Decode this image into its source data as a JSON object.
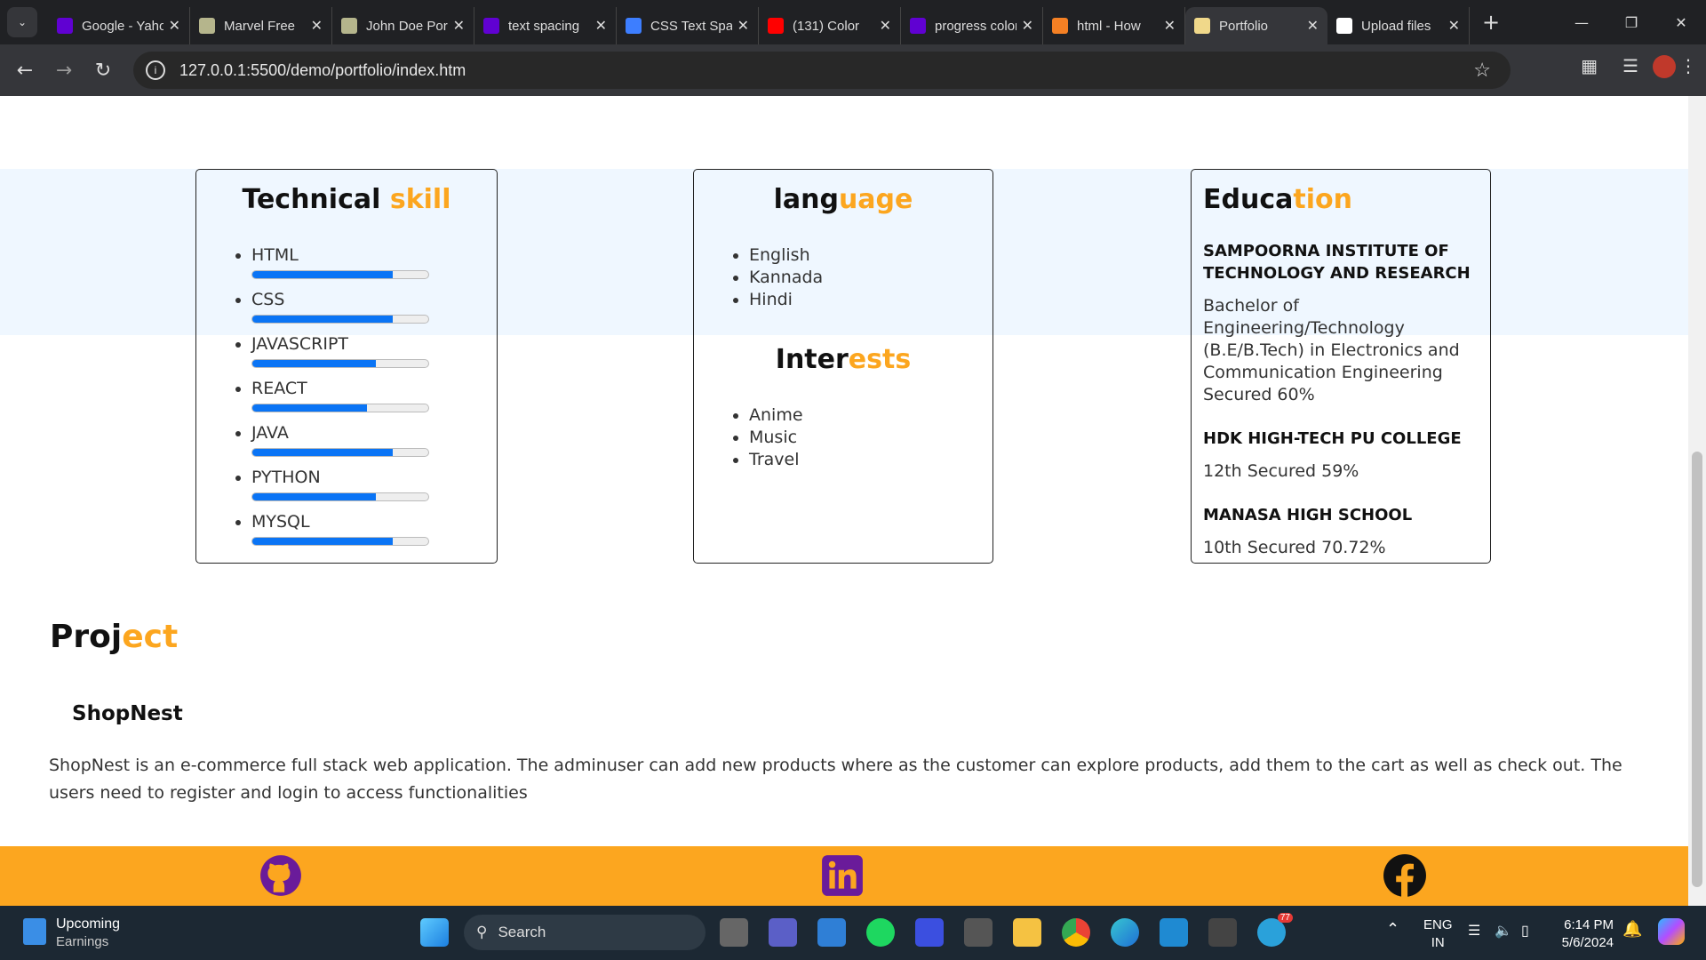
{
  "browser": {
    "tabs": [
      {
        "title": "Google - Yahoo",
        "icon": "yahoo-icon",
        "color": "#6001d2"
      },
      {
        "title": "Marvel Free",
        "icon": "page-icon",
        "color": "#b5b58c"
      },
      {
        "title": "John Doe Portfolio",
        "icon": "page-icon",
        "color": "#b5b58c"
      },
      {
        "title": "text spacing",
        "icon": "yahoo-icon",
        "color": "#6001d2"
      },
      {
        "title": "CSS Text Spacing",
        "icon": "css-icon",
        "color": "#3d7eff"
      },
      {
        "title": "(131) Color",
        "icon": "youtube-icon",
        "color": "#ff0000"
      },
      {
        "title": "progress color",
        "icon": "yahoo-icon",
        "color": "#6001d2"
      },
      {
        "title": "html - How",
        "icon": "stackoverflow-icon",
        "color": "#f48024"
      },
      {
        "title": "Portfolio",
        "icon": "portfolio-icon",
        "color": "#f0d88a",
        "active": true
      },
      {
        "title": "Upload files",
        "icon": "github-icon",
        "color": "#ffffff"
      }
    ],
    "url": "127.0.0.1:5500/demo/portfolio/index.htm"
  },
  "skills": {
    "title_a": "Technical ",
    "title_b": "skill",
    "items": [
      {
        "name": "HTML",
        "level": 80
      },
      {
        "name": "CSS",
        "level": 80
      },
      {
        "name": "JAVASCRIPT",
        "level": 70
      },
      {
        "name": "REACT",
        "level": 65
      },
      {
        "name": "JAVA",
        "level": 80
      },
      {
        "name": "PYTHON",
        "level": 70
      },
      {
        "name": "MYSQL",
        "level": 80
      }
    ],
    "bar_color": "#0a74f5"
  },
  "language": {
    "title_a": "lang",
    "title_b": "uage",
    "items": [
      "English",
      "Kannada",
      "Hindi"
    ]
  },
  "interests": {
    "title_a": "Inter",
    "title_b": "ests",
    "items": [
      "Anime",
      "Music",
      "Travel"
    ]
  },
  "education": {
    "title_a": "Educa",
    "title_b": "tion",
    "items": [
      {
        "school": "SAMPOORNA INSTITUTE OF TECHNOLOGY AND RESEARCH",
        "detail": "Bachelor of Engineering/Technology (B.E/B.Tech) in Electronics and Communication Engineering Secured 60%"
      },
      {
        "school": "HDK HIGH-TECH PU COLLEGE",
        "detail": "12th Secured 59%"
      },
      {
        "school": "MANASA HIGH SCHOOL",
        "detail": "10th Secured 70.72%"
      }
    ]
  },
  "project": {
    "title_a": "Proj",
    "title_b": "ect",
    "name": "ShopNest",
    "description": "ShopNest is an e-commerce full stack web application. The adminuser can add new products where as the customer can explore products, add them to the cart as well as check out. The users need to register and login to access functionalities"
  },
  "footer": {
    "accent": "#fca61f",
    "links": [
      "github-icon",
      "linkedin-icon",
      "facebook-icon"
    ]
  },
  "taskbar": {
    "widget_title": "Upcoming",
    "widget_sub": "Earnings",
    "search": "Search",
    "lang": "ENG",
    "region": "IN",
    "time": "6:14 PM",
    "date": "5/6/2024",
    "telegram_badge": "77"
  }
}
